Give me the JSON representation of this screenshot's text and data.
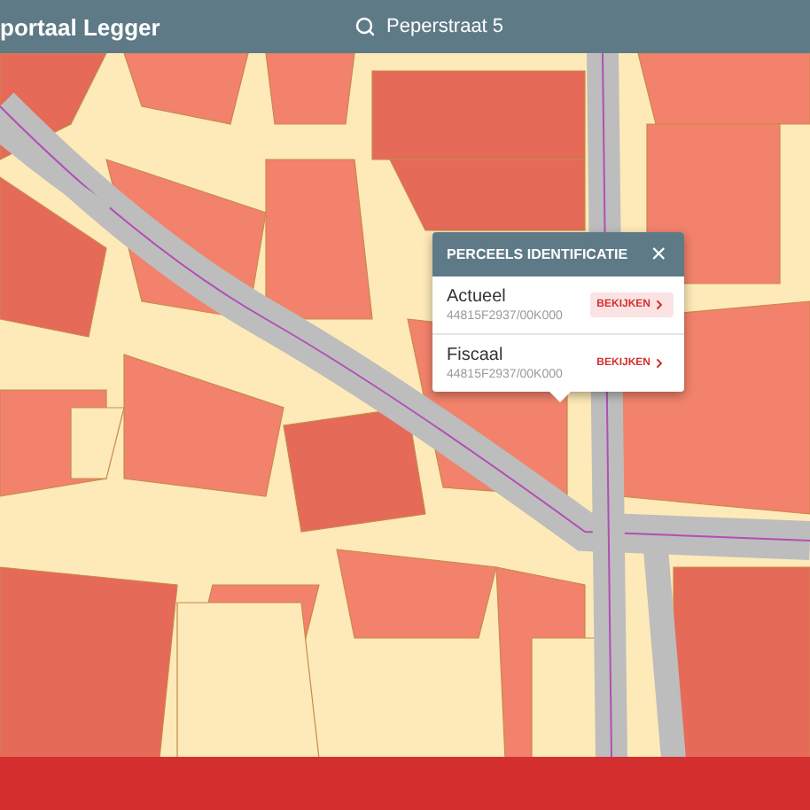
{
  "app_bar": {
    "title": "portaal Legger",
    "search": {
      "value": "Peperstraat 5"
    }
  },
  "popup": {
    "title": "PERCEELS IDENTIFICATIE",
    "close": "×",
    "rows": [
      {
        "label": "Actueel",
        "code": "44815F2937/00K000",
        "action": "BEKIJKEN",
        "highlighted": true
      },
      {
        "label": "Fiscaal",
        "code": "44815F2937/00K000",
        "action": "BEKIJKEN",
        "highlighted": false
      }
    ]
  }
}
